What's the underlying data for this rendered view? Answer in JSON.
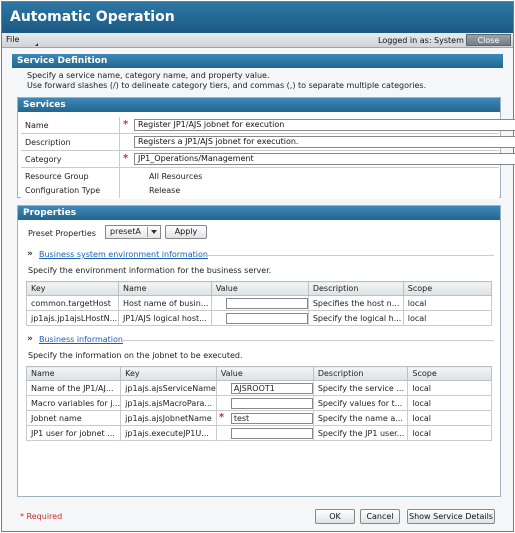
{
  "app": {
    "title": "Automatic Operation"
  },
  "menubar": {
    "file_label": "File",
    "logged_in_text": "Logged in as: System",
    "close_label": "Close"
  },
  "service_definition": {
    "header": "Service Definition",
    "intro_line1": "Specify a service name, category name, and property value.",
    "intro_line2": "Use forward slashes (/) to delineate category tiers, and commas (,) to separate multiple categories."
  },
  "services": {
    "header": "Services",
    "rows": [
      {
        "label": "Name",
        "value": "Register JP1/AJS jobnet for execution",
        "required": "*"
      },
      {
        "label": "Description",
        "value": "Registers a JP1/AJS jobnet for execution."
      },
      {
        "label": "Category",
        "value": "JP1_Operations/Management",
        "required": "*"
      },
      {
        "label": "Resource Group",
        "value": "All Resources"
      },
      {
        "label": "Configuration Type",
        "value": "Release"
      }
    ]
  },
  "properties": {
    "header": "Properties",
    "preset_label": "Preset Properties",
    "preset_value": "presetA",
    "apply_label": "Apply",
    "sections": [
      {
        "link": "Business system environment information",
        "description": "Specify the environment information for the business server.",
        "columns": [
          "Key",
          "Name",
          "Value",
          "Description",
          "Scope"
        ],
        "rows": [
          {
            "c1": "common.targetHost",
            "c2": "Host name of busin...",
            "value": "",
            "desc": "Specifies the host n...",
            "scope": "local"
          },
          {
            "c1": "jp1ajs.jp1ajsLHostN...",
            "c2": "JP1/AJS logical host...",
            "value": "",
            "desc": "Specify the logical h...",
            "scope": "local"
          }
        ]
      },
      {
        "link": "Business information",
        "description": "Specify the information on the jobnet to be executed.",
        "columns": [
          "Name",
          "Key",
          "Value",
          "Description",
          "Scope"
        ],
        "rows": [
          {
            "c1": "Name of the JP1/AJ...",
            "c2": "jp1ajs.ajsServiceName",
            "value": "AJSROOT1",
            "desc": "Specify the service ...",
            "scope": "local"
          },
          {
            "c1": "Macro variables for j...",
            "c2": "jp1ajs.ajsMacroPara...",
            "value": "",
            "desc": "Specify values for t...",
            "scope": "local"
          },
          {
            "c1": "Jobnet name",
            "c2": "jp1ajs.ajsJobnetName",
            "value": "test",
            "required": "*",
            "desc": "Specify the name a...",
            "scope": "local"
          },
          {
            "c1": "JP1 user for jobnet ...",
            "c2": "jp1ajs.executeJP1U...",
            "value": "",
            "desc": "Specify the JP1 user...",
            "scope": "local"
          }
        ]
      }
    ]
  },
  "footer": {
    "required_note": "* Required",
    "ok_label": "OK",
    "cancel_label": "Cancel",
    "details_label": "Show Service Details"
  }
}
